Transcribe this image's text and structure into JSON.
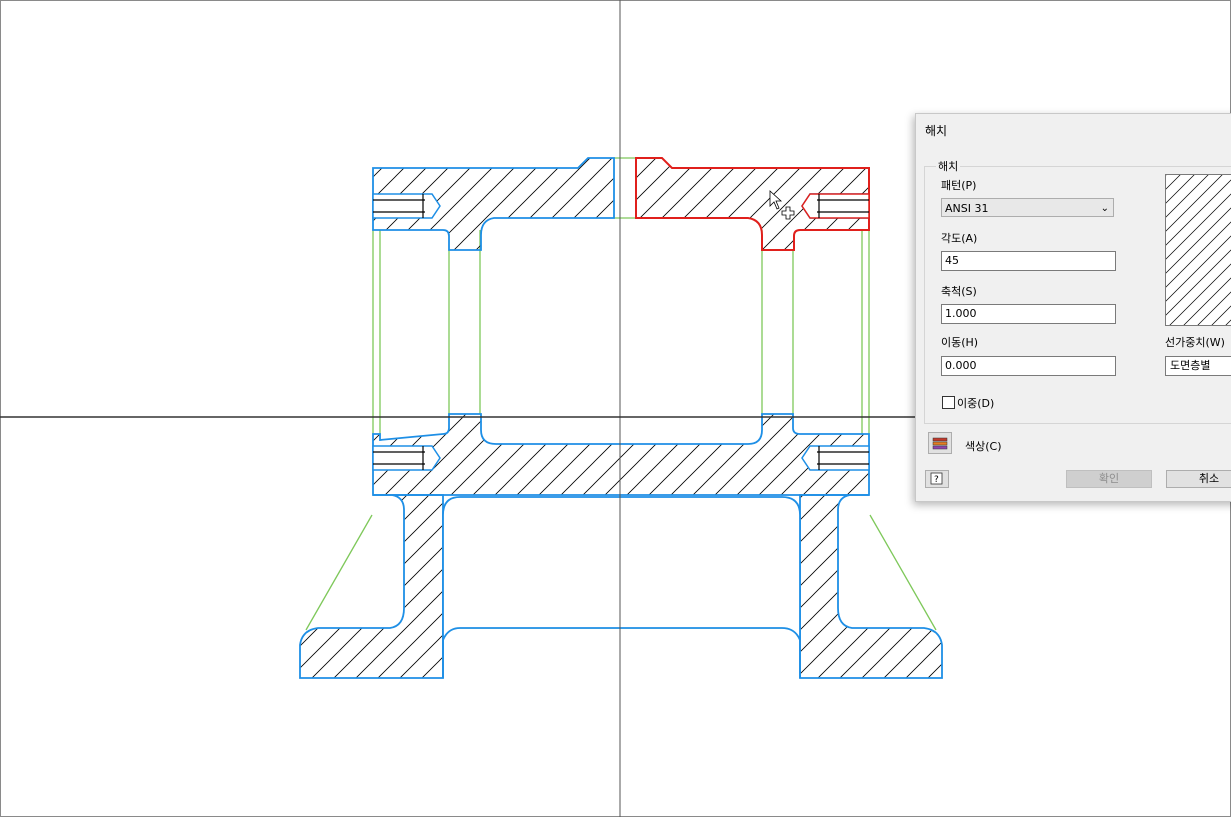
{
  "drawing": {
    "hatch_pattern_angle": 45,
    "colors": {
      "section_blue": "#1e8fe6",
      "selected_red": "#e0201c",
      "hidden_green": "#7ec85a",
      "axis": "#444444",
      "hatch": "#000000"
    }
  },
  "dialog": {
    "title": "해치",
    "group_label": "해치",
    "pattern_label": "패턴(P)",
    "pattern_value": "ANSI 31",
    "angle_label": "각도(A)",
    "angle_value": "45",
    "scale_label": "축척(S)",
    "scale_value": "1.000",
    "offset_label": "이동(H)",
    "offset_value": "0.000",
    "double_label": "이중(D)",
    "double_checked": false,
    "lineweight_label": "선가중치(W)",
    "lineweight_value": "도면층별",
    "color_label": "색상(C)",
    "ok_label": "확인",
    "cancel_label": "취소",
    "help_icon": "help-icon",
    "color_icon": "layers-color-icon"
  }
}
